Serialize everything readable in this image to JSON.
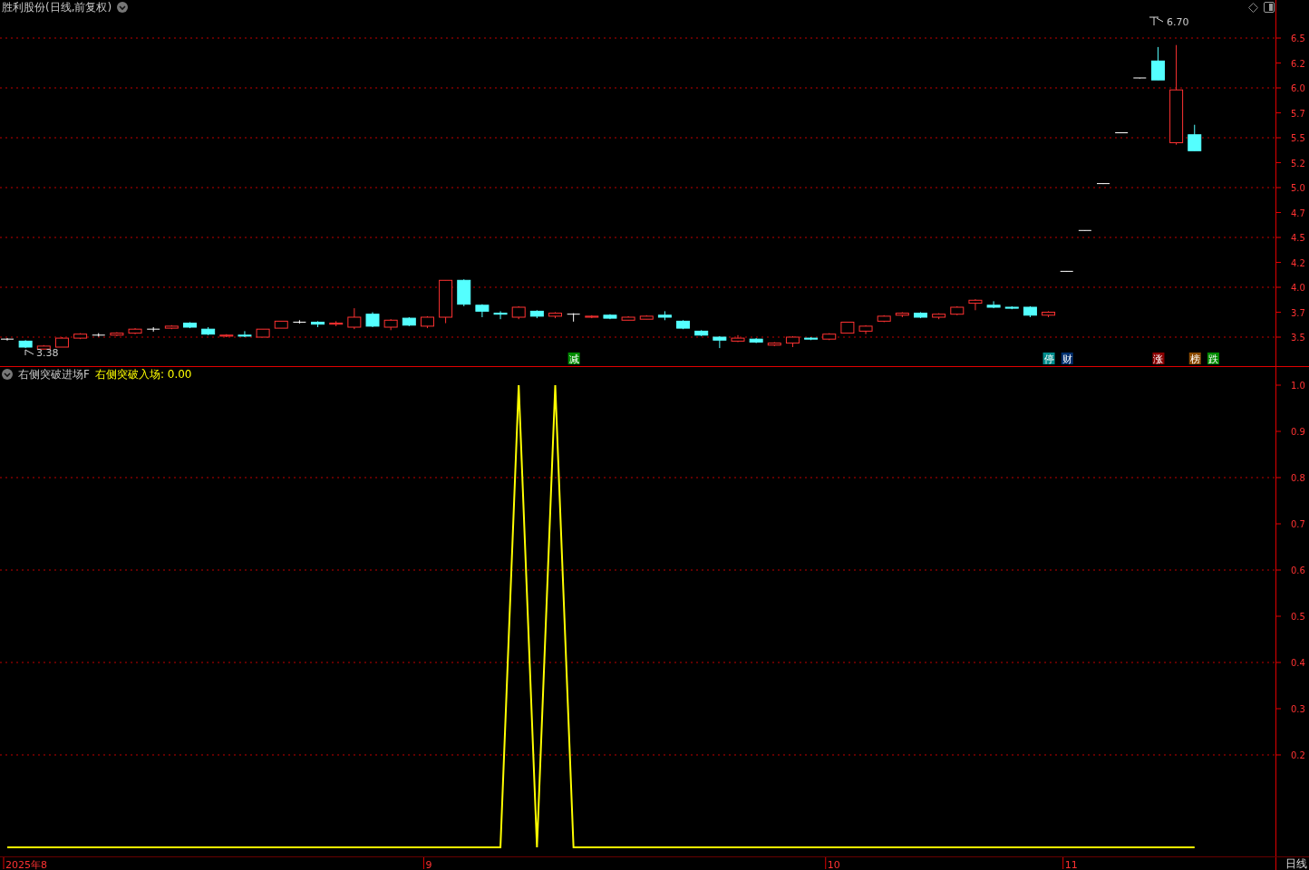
{
  "price_panel": {
    "title": "胜利股份(日线,前复权)",
    "axis_labels": [
      "6.5",
      "6.2",
      "6.0",
      "5.7",
      "5.5",
      "5.2",
      "5.0",
      "4.7",
      "4.5",
      "4.2",
      "4.0",
      "3.7",
      "3.5"
    ],
    "high_label": "6.70",
    "low_label": "3.38",
    "badges": [
      {
        "text": "减",
        "color": "#008a00"
      },
      {
        "text": "停",
        "color": "#008c8c"
      },
      {
        "text": "财",
        "color": "#00306e"
      },
      {
        "text": "涨",
        "color": "#8a0000"
      },
      {
        "text": "榜",
        "color": "#8a4a00"
      },
      {
        "text": "跌",
        "color": "#008a00"
      }
    ]
  },
  "indicator_panel": {
    "name": "右侧突破进场F",
    "reading": "右侧突破入场: 0.00",
    "axis_labels": [
      "1.0",
      "0.9",
      "0.8",
      "0.7",
      "0.6",
      "0.5",
      "0.4",
      "0.3",
      "0.2"
    ]
  },
  "time_axis": [
    "2025年8",
    "9",
    "10",
    "11"
  ],
  "period_label": "日线"
}
